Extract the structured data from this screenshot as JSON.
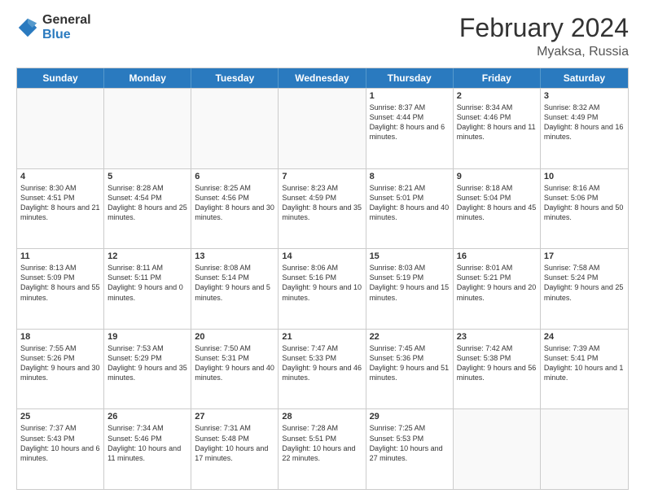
{
  "logo": {
    "general": "General",
    "blue": "Blue"
  },
  "header": {
    "month_year": "February 2024",
    "location": "Myaksa, Russia"
  },
  "days_of_week": [
    "Sunday",
    "Monday",
    "Tuesday",
    "Wednesday",
    "Thursday",
    "Friday",
    "Saturday"
  ],
  "weeks": [
    [
      {
        "day": "",
        "empty": true
      },
      {
        "day": "",
        "empty": true
      },
      {
        "day": "",
        "empty": true
      },
      {
        "day": "",
        "empty": true
      },
      {
        "day": "1",
        "sunrise": "8:37 AM",
        "sunset": "4:44 PM",
        "daylight": "8 hours and 6 minutes."
      },
      {
        "day": "2",
        "sunrise": "8:34 AM",
        "sunset": "4:46 PM",
        "daylight": "8 hours and 11 minutes."
      },
      {
        "day": "3",
        "sunrise": "8:32 AM",
        "sunset": "4:49 PM",
        "daylight": "8 hours and 16 minutes."
      }
    ],
    [
      {
        "day": "4",
        "sunrise": "8:30 AM",
        "sunset": "4:51 PM",
        "daylight": "8 hours and 21 minutes."
      },
      {
        "day": "5",
        "sunrise": "8:28 AM",
        "sunset": "4:54 PM",
        "daylight": "8 hours and 25 minutes."
      },
      {
        "day": "6",
        "sunrise": "8:25 AM",
        "sunset": "4:56 PM",
        "daylight": "8 hours and 30 minutes."
      },
      {
        "day": "7",
        "sunrise": "8:23 AM",
        "sunset": "4:59 PM",
        "daylight": "8 hours and 35 minutes."
      },
      {
        "day": "8",
        "sunrise": "8:21 AM",
        "sunset": "5:01 PM",
        "daylight": "8 hours and 40 minutes."
      },
      {
        "day": "9",
        "sunrise": "8:18 AM",
        "sunset": "5:04 PM",
        "daylight": "8 hours and 45 minutes."
      },
      {
        "day": "10",
        "sunrise": "8:16 AM",
        "sunset": "5:06 PM",
        "daylight": "8 hours and 50 minutes."
      }
    ],
    [
      {
        "day": "11",
        "sunrise": "8:13 AM",
        "sunset": "5:09 PM",
        "daylight": "8 hours and 55 minutes."
      },
      {
        "day": "12",
        "sunrise": "8:11 AM",
        "sunset": "5:11 PM",
        "daylight": "9 hours and 0 minutes."
      },
      {
        "day": "13",
        "sunrise": "8:08 AM",
        "sunset": "5:14 PM",
        "daylight": "9 hours and 5 minutes."
      },
      {
        "day": "14",
        "sunrise": "8:06 AM",
        "sunset": "5:16 PM",
        "daylight": "9 hours and 10 minutes."
      },
      {
        "day": "15",
        "sunrise": "8:03 AM",
        "sunset": "5:19 PM",
        "daylight": "9 hours and 15 minutes."
      },
      {
        "day": "16",
        "sunrise": "8:01 AM",
        "sunset": "5:21 PM",
        "daylight": "9 hours and 20 minutes."
      },
      {
        "day": "17",
        "sunrise": "7:58 AM",
        "sunset": "5:24 PM",
        "daylight": "9 hours and 25 minutes."
      }
    ],
    [
      {
        "day": "18",
        "sunrise": "7:55 AM",
        "sunset": "5:26 PM",
        "daylight": "9 hours and 30 minutes."
      },
      {
        "day": "19",
        "sunrise": "7:53 AM",
        "sunset": "5:29 PM",
        "daylight": "9 hours and 35 minutes."
      },
      {
        "day": "20",
        "sunrise": "7:50 AM",
        "sunset": "5:31 PM",
        "daylight": "9 hours and 40 minutes."
      },
      {
        "day": "21",
        "sunrise": "7:47 AM",
        "sunset": "5:33 PM",
        "daylight": "9 hours and 46 minutes."
      },
      {
        "day": "22",
        "sunrise": "7:45 AM",
        "sunset": "5:36 PM",
        "daylight": "9 hours and 51 minutes."
      },
      {
        "day": "23",
        "sunrise": "7:42 AM",
        "sunset": "5:38 PM",
        "daylight": "9 hours and 56 minutes."
      },
      {
        "day": "24",
        "sunrise": "7:39 AM",
        "sunset": "5:41 PM",
        "daylight": "10 hours and 1 minute."
      }
    ],
    [
      {
        "day": "25",
        "sunrise": "7:37 AM",
        "sunset": "5:43 PM",
        "daylight": "10 hours and 6 minutes."
      },
      {
        "day": "26",
        "sunrise": "7:34 AM",
        "sunset": "5:46 PM",
        "daylight": "10 hours and 11 minutes."
      },
      {
        "day": "27",
        "sunrise": "7:31 AM",
        "sunset": "5:48 PM",
        "daylight": "10 hours and 17 minutes."
      },
      {
        "day": "28",
        "sunrise": "7:28 AM",
        "sunset": "5:51 PM",
        "daylight": "10 hours and 22 minutes."
      },
      {
        "day": "29",
        "sunrise": "7:25 AM",
        "sunset": "5:53 PM",
        "daylight": "10 hours and 27 minutes."
      },
      {
        "day": "",
        "empty": true
      },
      {
        "day": "",
        "empty": true
      }
    ]
  ]
}
